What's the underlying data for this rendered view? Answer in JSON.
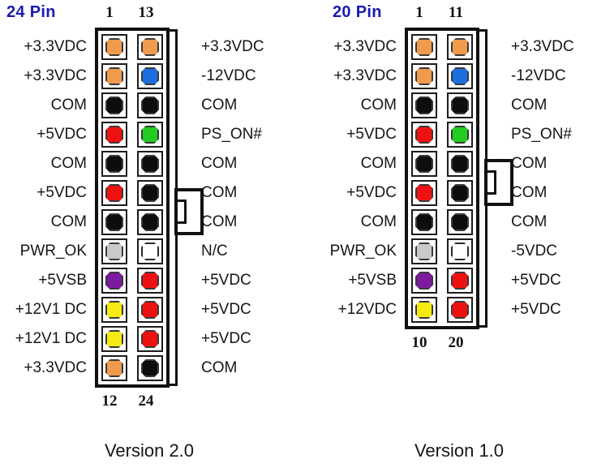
{
  "page": {
    "background": "#ffffff",
    "accent_blue": "#1a1ab4"
  },
  "palette": {
    "orange": "#f09a4e",
    "blue": "#1d6fe0",
    "black": "#0d0d0d",
    "red": "#ee1111",
    "green": "#22cc22",
    "gray": "#c9c9c9",
    "white": "#ffffff",
    "purple": "#7d1a9e",
    "yellow": "#f5ea12"
  },
  "connectors": [
    {
      "id": "atx-24-pin",
      "title": "24 Pin",
      "version": "Version 2.0",
      "top_numbers": {
        "left": "1",
        "right": "13"
      },
      "bottom_numbers": {
        "left": "12",
        "right": "24"
      },
      "rows": [
        {
          "left_label": "+3.3VDC",
          "left_color": "orange",
          "right_color": "orange",
          "right_label": "+3.3VDC"
        },
        {
          "left_label": "+3.3VDC",
          "left_color": "orange",
          "right_color": "blue",
          "right_label": "-12VDC"
        },
        {
          "left_label": "COM",
          "left_color": "black",
          "right_color": "black",
          "right_label": "COM"
        },
        {
          "left_label": "+5VDC",
          "left_color": "red",
          "right_color": "green",
          "right_label": "PS_ON#"
        },
        {
          "left_label": "COM",
          "left_color": "black",
          "right_color": "black",
          "right_label": "COM"
        },
        {
          "left_label": "+5VDC",
          "left_color": "red",
          "right_color": "black",
          "right_label": "COM"
        },
        {
          "left_label": "COM",
          "left_color": "black",
          "right_color": "black",
          "right_label": "COM"
        },
        {
          "left_label": "PWR_OK",
          "left_color": "gray",
          "right_color": "white",
          "right_label": "N/C"
        },
        {
          "left_label": "+5VSB",
          "left_color": "purple",
          "right_color": "red",
          "right_label": "+5VDC"
        },
        {
          "left_label": "+12V1 DC",
          "left_color": "yellow",
          "right_color": "red",
          "right_label": "+5VDC"
        },
        {
          "left_label": "+12V1 DC",
          "left_color": "yellow",
          "right_color": "red",
          "right_label": "+5VDC"
        },
        {
          "left_label": "+3.3VDC",
          "left_color": "orange",
          "right_color": "black",
          "right_label": "COM"
        }
      ]
    },
    {
      "id": "atx-20-pin",
      "title": "20 Pin",
      "version": "Version 1.0",
      "top_numbers": {
        "left": "1",
        "right": "11"
      },
      "bottom_numbers": {
        "left": "10",
        "right": "20"
      },
      "rows": [
        {
          "left_label": "+3.3VDC",
          "left_color": "orange",
          "right_color": "orange",
          "right_label": "+3.3VDC"
        },
        {
          "left_label": "+3.3VDC",
          "left_color": "orange",
          "right_color": "blue",
          "right_label": "-12VDC"
        },
        {
          "left_label": "COM",
          "left_color": "black",
          "right_color": "black",
          "right_label": "COM"
        },
        {
          "left_label": "+5VDC",
          "left_color": "red",
          "right_color": "green",
          "right_label": "PS_ON#"
        },
        {
          "left_label": "COM",
          "left_color": "black",
          "right_color": "black",
          "right_label": "COM"
        },
        {
          "left_label": "+5VDC",
          "left_color": "red",
          "right_color": "black",
          "right_label": "COM"
        },
        {
          "left_label": "COM",
          "left_color": "black",
          "right_color": "black",
          "right_label": "COM"
        },
        {
          "left_label": "PWR_OK",
          "left_color": "gray",
          "right_color": "white",
          "right_label": "-5VDC"
        },
        {
          "left_label": "+5VSB",
          "left_color": "purple",
          "right_color": "red",
          "right_label": "+5VDC"
        },
        {
          "left_label": "+12VDC",
          "left_color": "yellow",
          "right_color": "red",
          "right_label": "+5VDC"
        }
      ]
    }
  ]
}
